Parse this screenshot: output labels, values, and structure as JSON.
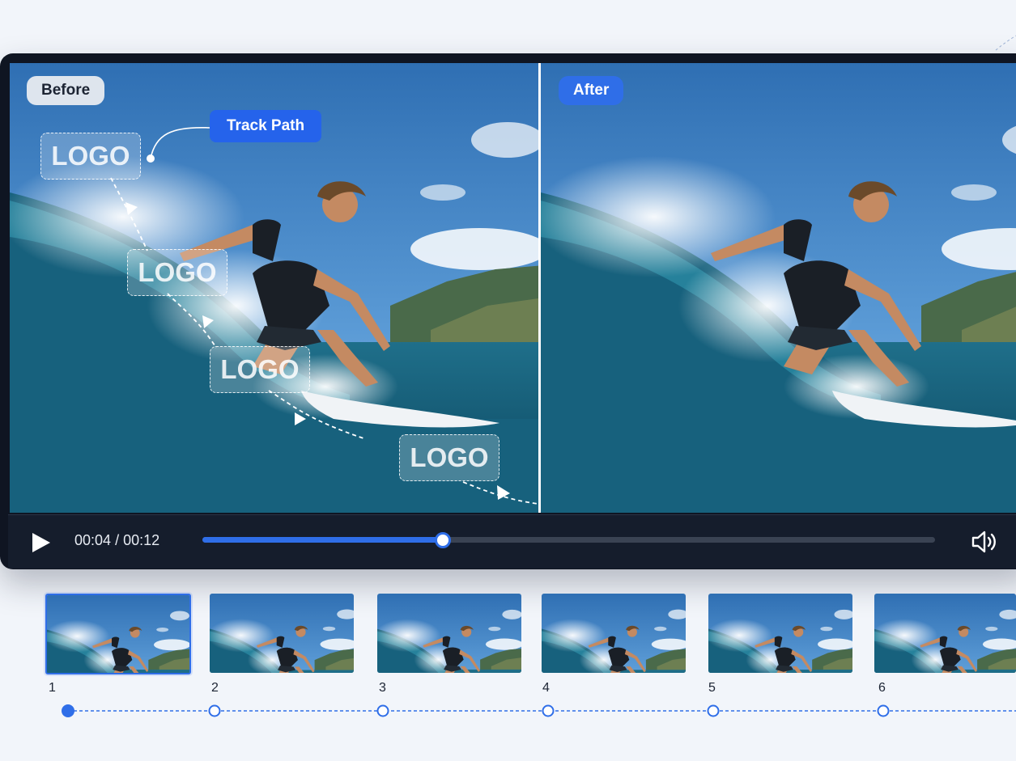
{
  "badges": {
    "before": "Before",
    "after": "After"
  },
  "track_path": {
    "label": "Track Path"
  },
  "watermark": {
    "text": "LOGO"
  },
  "player": {
    "current_time": "00:04",
    "separator": "/",
    "duration": "00:12",
    "progress_fraction": 0.327
  },
  "filmstrip": {
    "frames": [
      {
        "number": "1",
        "active": true
      },
      {
        "number": "2",
        "active": false
      },
      {
        "number": "3",
        "active": false
      },
      {
        "number": "4",
        "active": false
      },
      {
        "number": "5",
        "active": false
      },
      {
        "number": "6",
        "active": false
      }
    ]
  },
  "icons": {
    "play": "play-icon",
    "volume": "volume-icon"
  },
  "colors": {
    "accent": "#2f6ee8",
    "player_bg": "#0f1522",
    "page_bg": "#f2f5fa"
  }
}
